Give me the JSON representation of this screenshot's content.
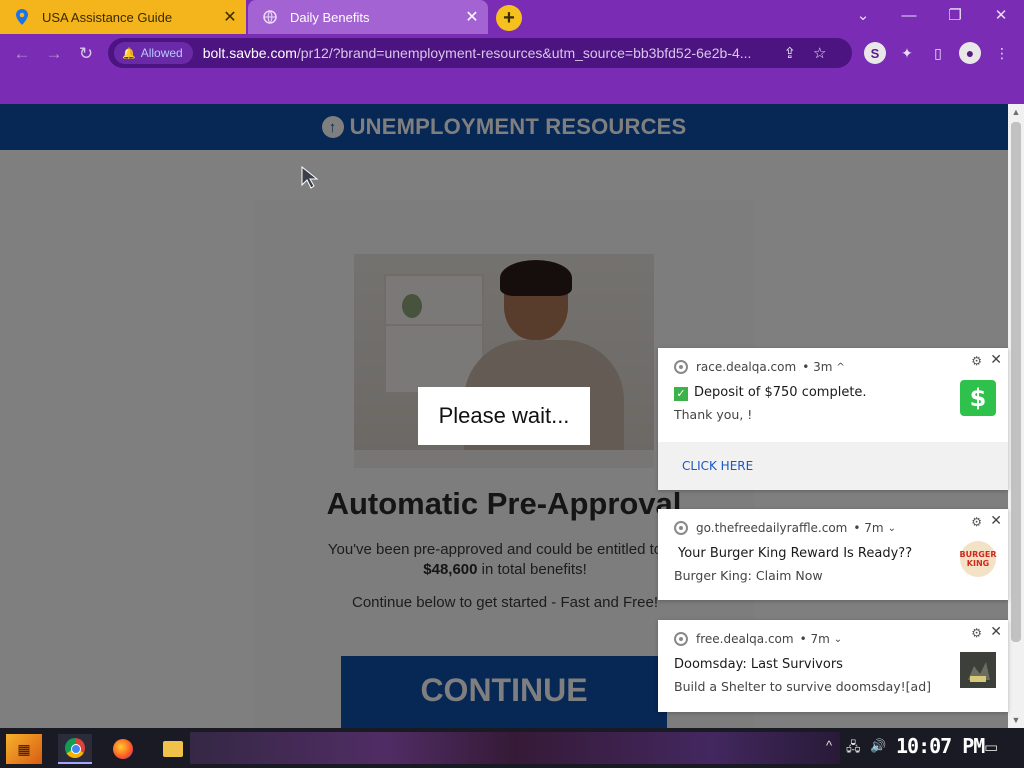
{
  "browser": {
    "tabs": [
      {
        "title": "USA Assistance Guide",
        "active": false
      },
      {
        "title": "Daily Benefits",
        "active": true
      }
    ],
    "new_tab_label": "+",
    "permission_chip": "Allowed",
    "url_host": "bolt.savbe.com",
    "url_path": "/pr12/?brand=unemployment-resources&utm_source=bb3bfd52-6e2b-4..."
  },
  "site": {
    "header_title": "UNEMPLOYMENT RESOURCES",
    "headline": "Automatic Pre-Approval",
    "subtext_line1": "You've been pre-approved and could be entitled to as",
    "amount": "$48,600",
    "subtext_line2": " in total benefits!",
    "subtext2": "Continue below to get started - Fast and Free!",
    "continue_label": "CONTINUE",
    "wait_text": "Please wait..."
  },
  "notifications": [
    {
      "domain": "race.dealqa.com",
      "time": "• 3m",
      "title": "Deposit of $750 complete.",
      "body": "Thank you, !",
      "action": "CLICK HERE",
      "thumb_icon": "dollar-icon",
      "thumb_text": "$"
    },
    {
      "domain": "go.thefreedailyraffle.com",
      "time": "• 7m",
      "title": "Your Burger King Reward Is Ready??",
      "body": "Burger King:  Claim Now",
      "thumb_icon": "burger-king-logo",
      "thumb_text": "BURGER KING"
    },
    {
      "domain": "free.dealqa.com",
      "time": "• 7m",
      "title": "Doomsday: Last Survivors",
      "body": "Build a Shelter to survive doomsday![ad]",
      "thumb_icon": "game-thumbnail"
    }
  ],
  "taskbar": {
    "clock": "10:07 PM"
  },
  "colors": {
    "chrome_purple": "#7b2cb5",
    "site_blue": "#0e4fa8",
    "tab_yellow": "#f3b51b"
  }
}
